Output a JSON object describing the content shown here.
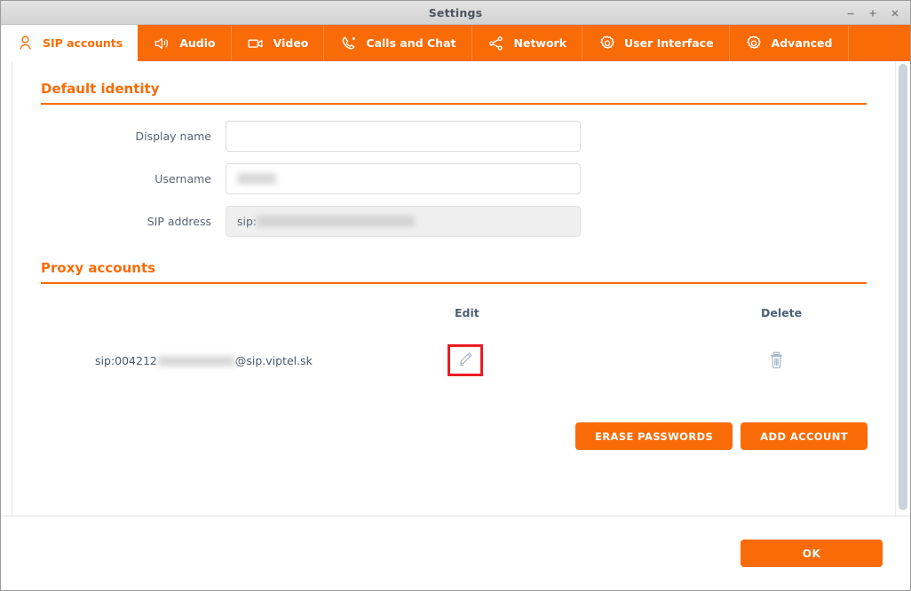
{
  "window": {
    "title": "Settings",
    "controls": [
      {
        "name": "minimize",
        "glyph": "minimize-icon"
      },
      {
        "name": "maximize",
        "glyph": "maximize-icon"
      },
      {
        "name": "close",
        "glyph": "close-icon"
      }
    ]
  },
  "tabs": [
    {
      "id": "sip-accounts",
      "label": "SIP accounts",
      "icon": "user-icon",
      "active": true
    },
    {
      "id": "audio",
      "label": "Audio",
      "icon": "speaker-icon",
      "active": false
    },
    {
      "id": "video",
      "label": "Video",
      "icon": "camera-icon",
      "active": false
    },
    {
      "id": "calls-and-chat",
      "label": "Calls and Chat",
      "icon": "phone-icon",
      "active": false
    },
    {
      "id": "network",
      "label": "Network",
      "icon": "share-icon",
      "active": false
    },
    {
      "id": "user-interface",
      "label": "User Interface",
      "icon": "gear-icon",
      "active": false
    },
    {
      "id": "advanced",
      "label": "Advanced",
      "icon": "gear-icon",
      "active": false
    }
  ],
  "default_identity": {
    "heading": "Default identity",
    "fields": [
      {
        "id": "display-name",
        "label": "Display name",
        "value": "",
        "redacted": false,
        "readonly": false
      },
      {
        "id": "username",
        "label": "Username",
        "value": "",
        "redacted": true,
        "readonly": false
      },
      {
        "id": "sip-address",
        "label": "SIP address",
        "value": "sip:",
        "redacted": true,
        "readonly": true
      }
    ]
  },
  "proxy_accounts": {
    "heading": "Proxy accounts",
    "columns": {
      "account": "",
      "edit": "Edit",
      "delete": "Delete"
    },
    "rows": [
      {
        "account_prefix": "sip:004212",
        "account_suffix": "@sip.viptel.sk",
        "account_redacted": true,
        "edit_icon": "pencil-icon",
        "delete_icon": "trash-icon",
        "edit_highlighted": true
      }
    ],
    "buttons": [
      {
        "id": "erase-passwords",
        "label": "ERASE PASSWORDS"
      },
      {
        "id": "add-account",
        "label": "ADD ACCOUNT"
      }
    ]
  },
  "footer": {
    "ok_label": "OK"
  },
  "colors": {
    "accent": "#f96b07",
    "titlebar": "#dadada",
    "highlight": "#ec1c24",
    "label_text": "#5a6472",
    "header_text": "#4a6178",
    "field_border": "#dcdcdc",
    "readonly_bg": "#efefef",
    "trash_icon": "#a9bacb",
    "scrollbar_thumb": "#cdd3da"
  }
}
